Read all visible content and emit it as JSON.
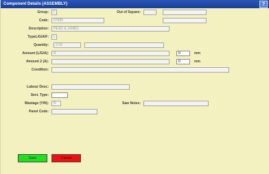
{
  "window": {
    "title": "Component Details (ASSEMBLY)",
    "help_icon": "?"
  },
  "fields": {
    "group": {
      "label": "Group:",
      "value": "I"
    },
    "out_of_square": {
      "label": "Out of Square:",
      "value": "",
      "value2": ""
    },
    "code": {
      "label": "Code:",
      "value": "07935",
      "value2": ""
    },
    "description": {
      "label": "Description:",
      "value": "HEAD & JAMBS"
    },
    "type": {
      "label": "TypeL/G/A/F:",
      "value": "L"
    },
    "quantity": {
      "label": "Quantity:",
      "value": "2.00",
      "value2": ""
    },
    "amount_lga": {
      "label": "Amount (L/G/A):",
      "value": "R",
      "num": "0",
      "unit": "mm"
    },
    "amount2": {
      "label": "Amount 2 (A):",
      "value": "",
      "num": "0",
      "unit": "mm"
    },
    "condition": {
      "label": "Condition:",
      "value": ""
    },
    "labour_desc": {
      "label": "Labour Desc:",
      "value": ""
    },
    "sect_type": {
      "label": "Sect. Type:",
      "value": ""
    },
    "wastage": {
      "label": "Wastage (Y/N):",
      "value": "N"
    },
    "saw_notes": {
      "label": "Saw Notes:",
      "value": ""
    },
    "panel_code": {
      "label": "Panel Code:",
      "value": ""
    }
  },
  "buttons": {
    "save": "Save",
    "cancel": "Cancel"
  },
  "colors": {
    "title_bar": "#1b3f96",
    "background": "#f3f1bf",
    "save": "#22dd22",
    "cancel": "#ee1111"
  }
}
